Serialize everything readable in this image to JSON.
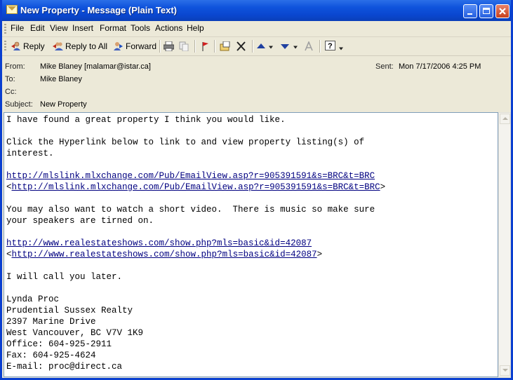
{
  "window": {
    "title": "New Property - Message (Plain Text)"
  },
  "menu": [
    "File",
    "Edit",
    "View",
    "Insert",
    "Format",
    "Tools",
    "Actions",
    "Help"
  ],
  "toolbar": {
    "reply": "Reply",
    "reply_all": "Reply to All",
    "forward": "Forward"
  },
  "header": {
    "from_label": "From:",
    "from_value": "Mike Blaney [malamar@istar.ca]",
    "to_label": "To:",
    "to_value": "Mike Blaney",
    "cc_label": "Cc:",
    "cc_value": "",
    "subject_label": "Subject:",
    "subject_value": "New Property",
    "sent_label": "Sent:",
    "sent_value": "Mon 7/17/2006 4:25 PM"
  },
  "body": {
    "line1": "I have found a great property I think you would like.",
    "line2": "Click the Hyperlink below to link to and view property listing(s) of",
    "line3": "interest.",
    "link1": "http://mlslink.mlxchange.com/Pub/EmailView.asp?r=905391591&s=BRC&t=BRC",
    "link1_bracket": "http://mlslink.mlxchange.com/Pub/EmailView.asp?r=905391591&s=BRC&t=BRC",
    "line4": "You may also want to watch a short video.  There is music so make sure",
    "line5": "your speakers are tirned on.",
    "link2": "http://www.realestateshows.com/show.php?mls=basic&id=42087",
    "link2_bracket": "http://www.realestateshows.com/show.php?mls=basic&id=42087",
    "line6": "I will call you later.",
    "sig1": "Lynda Proc",
    "sig2": "Prudential Sussex Realty",
    "sig3": "2397 Marine Drive",
    "sig4": "West Vancouver, BC V7V 1K9",
    "sig5": "Office: 604-925-2911",
    "sig6": "Fax: 604-925-4624",
    "sig7": "E-mail: proc@direct.ca"
  }
}
